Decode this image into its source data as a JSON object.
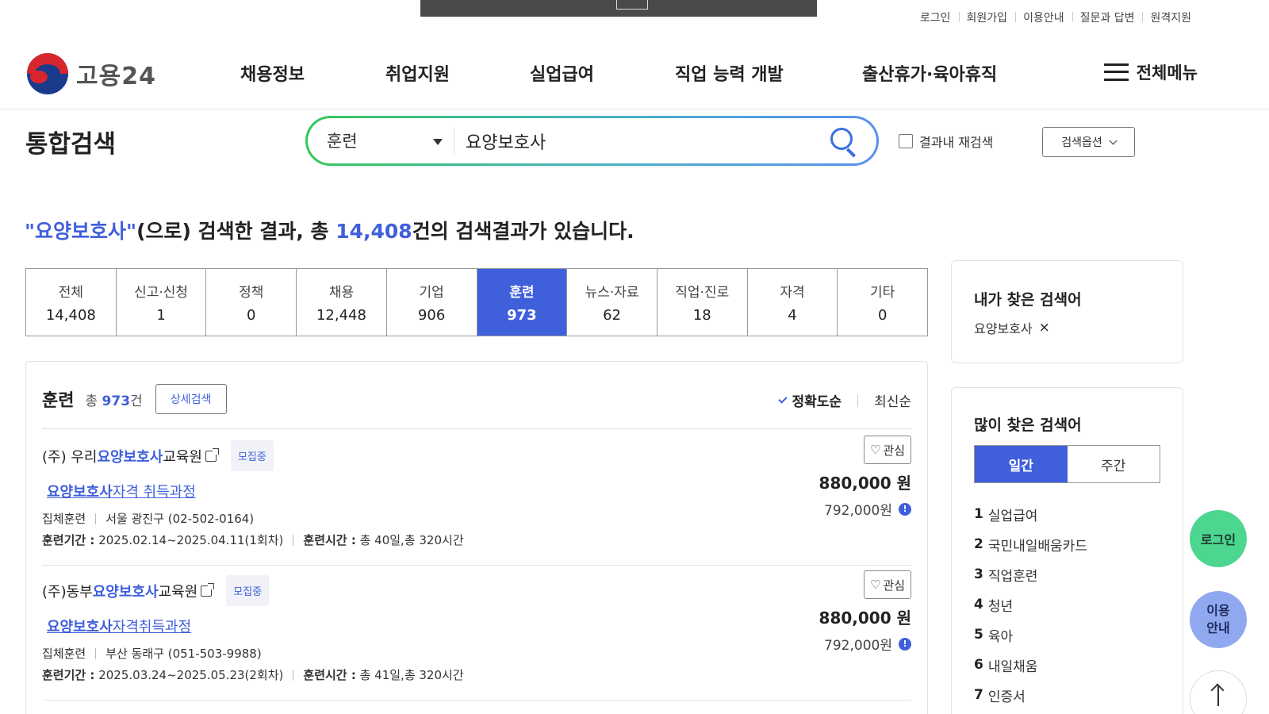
{
  "header": {
    "util_links": [
      "로그인",
      "회원가입",
      "이용안내",
      "질문과 답변",
      "원격지원"
    ],
    "logo_text": "고용24",
    "nav": [
      "채용정보",
      "취업지원",
      "실업급여",
      "직업 능력 개발",
      "출산휴가·육아휴직"
    ],
    "all_menu": "전체메뉴"
  },
  "search": {
    "page_title": "통합검색",
    "category": "훈련",
    "query": "요양보호사",
    "recheck_label": "결과내 재검색",
    "options_label": "검색옵션"
  },
  "summary": {
    "query_quoted": "\"요양보호사\"",
    "text1": "(으로) 검색한 결과, 총 ",
    "count": "14,408",
    "text2": "건의 검색결과가 있습니다."
  },
  "tabs": [
    {
      "label": "전체",
      "count": "14,408"
    },
    {
      "label": "신고·신청",
      "count": "1"
    },
    {
      "label": "정책",
      "count": "0"
    },
    {
      "label": "채용",
      "count": "12,448"
    },
    {
      "label": "기업",
      "count": "906"
    },
    {
      "label": "훈련",
      "count": "973",
      "active": true
    },
    {
      "label": "뉴스·자료",
      "count": "62"
    },
    {
      "label": "직업·진로",
      "count": "18"
    },
    {
      "label": "자격",
      "count": "4"
    },
    {
      "label": "기타",
      "count": "0"
    }
  ],
  "panel": {
    "title": "훈련",
    "total_prefix": "총 ",
    "total_count": "973",
    "total_suffix": "건",
    "detail_button": "상세검색",
    "sort_active": "정확도순",
    "sort_other": "최신순"
  },
  "courses": [
    {
      "org_pre": "(주) 우리",
      "org_hl": "요양보호사",
      "org_post": "교육원",
      "badge": "모집중",
      "name_hl": "요양보호사",
      "name_rest": "자격 취득과정",
      "type": "집체훈련",
      "location": "서울 광진구 (02-502-0164)",
      "period_label": "훈련기간 :",
      "period": "2025.02.14~2025.04.11(1회차)",
      "hours_label": "훈련시간 :",
      "hours": "총 40일,총 320시간",
      "fav": "관심",
      "price": "880,000 원",
      "price_self": "792,000원"
    },
    {
      "org_pre": "(주)동부",
      "org_hl": "요양보호사",
      "org_post": "교육원",
      "badge": "모집중",
      "name_hl": "요양보호사",
      "name_rest": "자격취득과정",
      "type": "집체훈련",
      "location": "부산 동래구 (051-503-9988)",
      "period_label": "훈련기간 :",
      "period": "2025.03.24~2025.05.23(2회차)",
      "hours_label": "훈련시간 :",
      "hours": "총 41일,총 320시간",
      "fav": "관심",
      "price": "880,000 원",
      "price_self": "792,000원"
    }
  ],
  "sidebar": {
    "recent_title": "내가 찾은 검색어",
    "recent_words": [
      "요양보호사"
    ],
    "popular_title": "많이 찾은 검색어",
    "period_tabs": [
      "일간",
      "주간"
    ],
    "popular": [
      {
        "rank": "1",
        "word": "실업급여"
      },
      {
        "rank": "2",
        "word": "국민내일배움카드"
      },
      {
        "rank": "3",
        "word": "직업훈련"
      },
      {
        "rank": "4",
        "word": "청년"
      },
      {
        "rank": "5",
        "word": "육아"
      },
      {
        "rank": "6",
        "word": "내일채움"
      },
      {
        "rank": "7",
        "word": "인증서"
      }
    ]
  },
  "floating": {
    "login": "로그인",
    "guide_line1": "이용",
    "guide_line2": "안내"
  },
  "colors": {
    "accent": "#3f5fdb",
    "login_float": "#4cd68f",
    "guide_float": "#8fa8ef"
  }
}
